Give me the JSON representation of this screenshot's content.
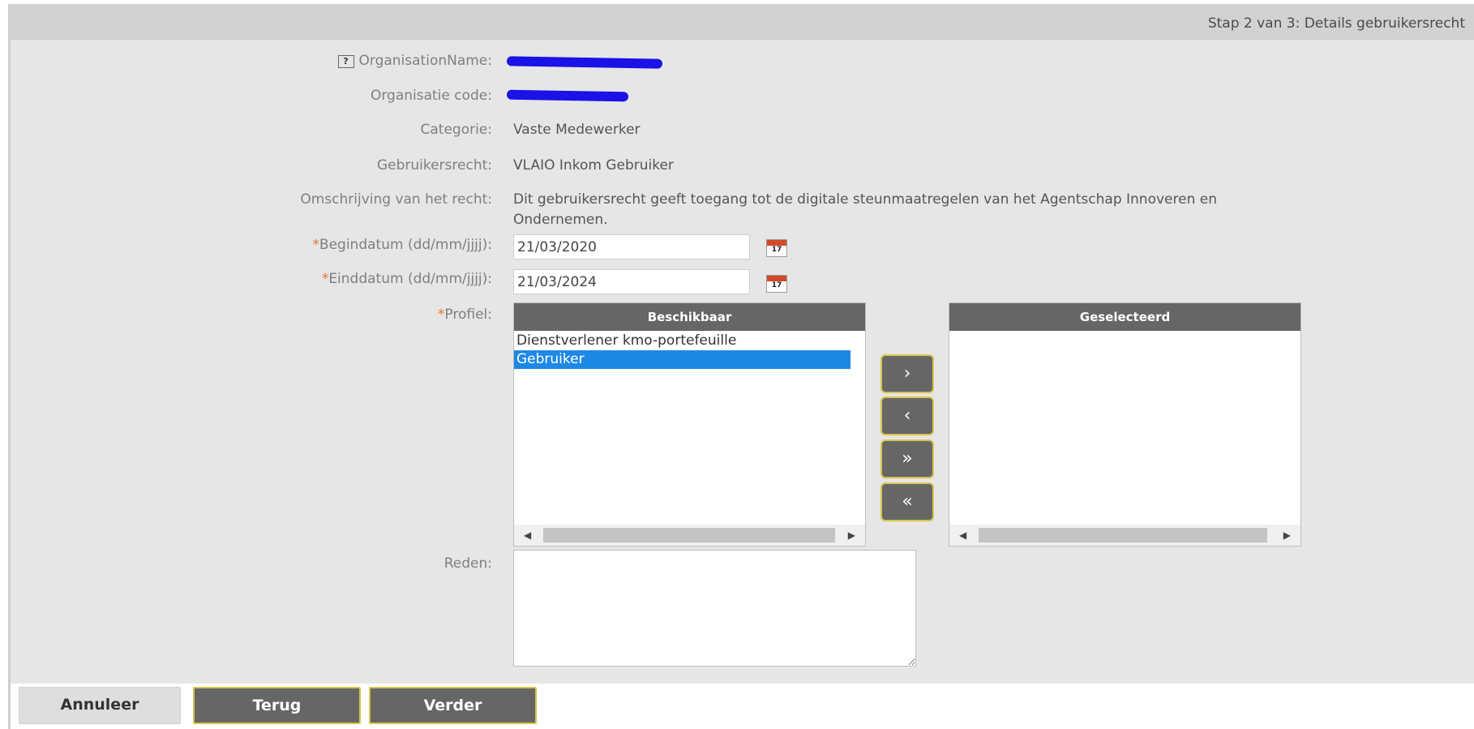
{
  "header": {
    "step_title": "Stap 2 van 3: Details gebruikersrecht"
  },
  "fields": {
    "organisation_name": {
      "help": "?",
      "label": "OrganisationName:"
    },
    "organisation_code": {
      "label": "Organisatie code:"
    },
    "categorie": {
      "label": "Categorie:",
      "value": "Vaste Medewerker"
    },
    "gebruikersrecht": {
      "label": "Gebruikersrecht:",
      "value": "VLAIO Inkom Gebruiker"
    },
    "omschrijving": {
      "label": "Omschrijving van het recht:",
      "value_line1": "Dit gebruikersrecht geeft toegang tot de digitale steunmaatregelen van het Agentschap Innoveren en",
      "value_line2": "Ondernemen."
    },
    "begindatum": {
      "required_mark": "*",
      "label": "Begindatum (dd/mm/jjjj):",
      "value": "21/03/2020",
      "calendar_day": "17"
    },
    "einddatum": {
      "required_mark": "*",
      "label": "Einddatum (dd/mm/jjjj):",
      "value": "21/03/2024",
      "calendar_day": "17"
    },
    "profiel": {
      "required_mark": "*",
      "label": "Profiel:",
      "available_header": "Beschikbaar",
      "selected_header": "Geselecteerd",
      "available_items": [
        "Dienstverlener kmo-portefeuille",
        "Gebruiker"
      ],
      "selected_available_item": "Gebruiker",
      "selected_items": []
    },
    "reden": {
      "label": "Reden:",
      "value": ""
    }
  },
  "move_buttons": {
    "add": "›",
    "remove": "‹",
    "add_all": "»",
    "remove_all": "«"
  },
  "footer": {
    "cancel_label": "Annuleer",
    "back_label": "Terug",
    "next_label": "Verder"
  },
  "colors": {
    "accent_selected": "#1e88e5",
    "button_dark": "#666666",
    "button_border": "#d9c34a",
    "required": "#e8742c",
    "redaction": "#1a12e6"
  }
}
